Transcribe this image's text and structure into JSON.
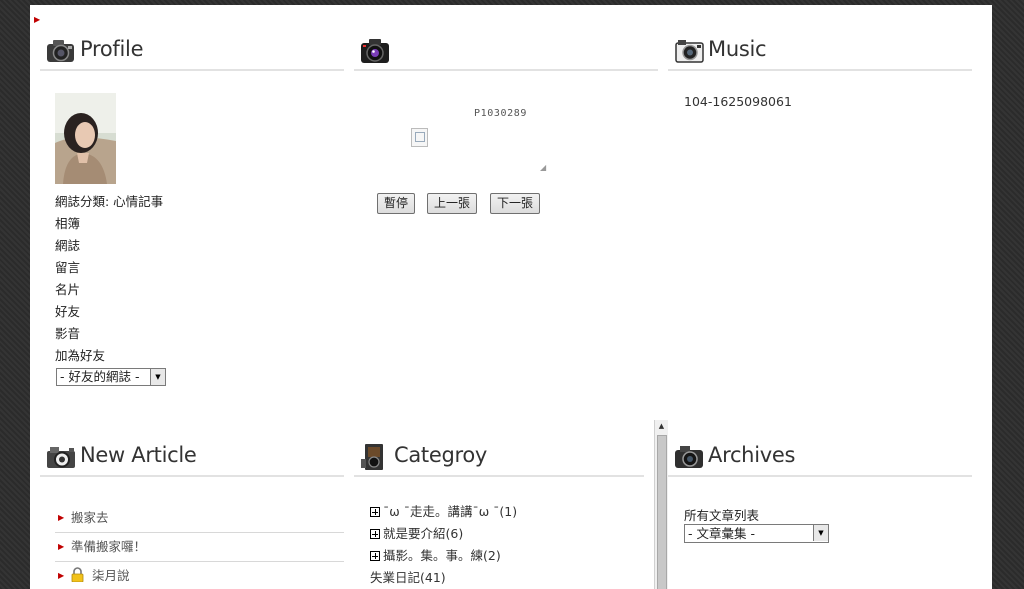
{
  "profile": {
    "title": "Profile",
    "links": [
      "網誌分類: 心情記事",
      "相簿",
      "網誌",
      "留言",
      "名片",
      "好友",
      "影音",
      "加為好友"
    ],
    "friend_select": "- 好友的網誌 -"
  },
  "photo": {
    "caption": "P1030289",
    "buttons": {
      "pause": "暫停",
      "prev": "上一張",
      "next": "下一張"
    }
  },
  "music": {
    "title": "Music",
    "number": "104-1625098061"
  },
  "new_article": {
    "title": "New Article",
    "items": [
      "搬家去",
      "準備搬家囉！",
      "柒月說"
    ]
  },
  "category": {
    "title": "Categroy",
    "items": [
      "ˉω ˉ走走。講講ˉω ˉ(1)",
      "就是要介紹(6)",
      "攝影。集。事。練(2)",
      "失業日記(41)"
    ]
  },
  "archives": {
    "title": "Archives",
    "label": "所有文章列表",
    "select": "- 文章彙集 -"
  },
  "colors": {
    "accent_bullet": "#c00000",
    "page_bg": "#ffffff",
    "outer_bg": "#2e2e2e"
  }
}
